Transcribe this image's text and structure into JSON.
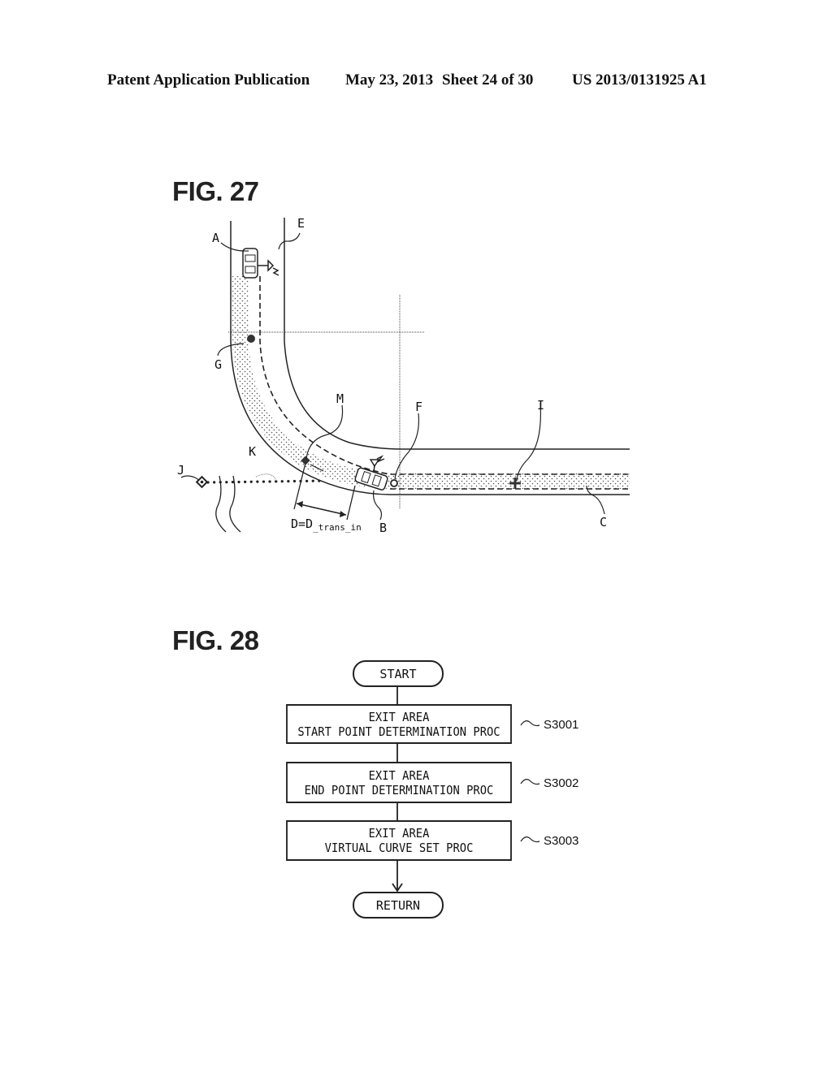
{
  "header": {
    "left": "Patent Application Publication",
    "date": "May 23, 2013",
    "sheet": "Sheet 24 of 30",
    "number": "US 2013/0131925 A1"
  },
  "fig27": {
    "title": "FIG. 27",
    "labels": {
      "A": "A",
      "E": "E",
      "G": "G",
      "M": "M",
      "F": "F",
      "I": "I",
      "J": "J",
      "K": "K",
      "B": "B",
      "C": "C",
      "D_main": "D=D",
      "D_sub": "_trans_in"
    }
  },
  "fig28": {
    "title": "FIG. 28",
    "start": "START",
    "steps": [
      {
        "line1": "EXIT AREA",
        "line2": "START POINT DETERMINATION PROC",
        "id": "S3001"
      },
      {
        "line1": "EXIT AREA",
        "line2": "END POINT DETERMINATION PROC",
        "id": "S3002"
      },
      {
        "line1": "EXIT AREA",
        "line2": "VIRTUAL CURVE SET PROC",
        "id": "S3003"
      }
    ],
    "end": "RETURN"
  }
}
